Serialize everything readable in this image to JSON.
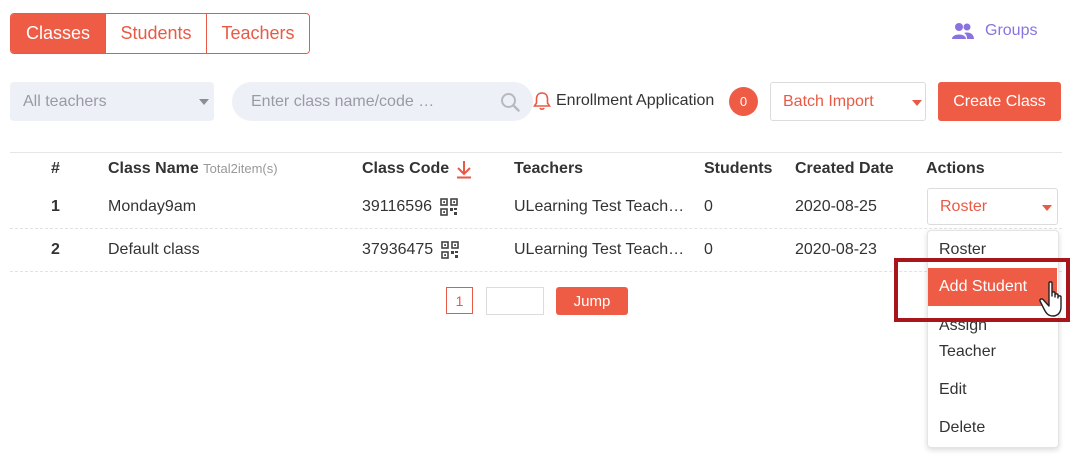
{
  "tabs": [
    {
      "label": "Classes",
      "active": true
    },
    {
      "label": "Students",
      "active": false
    },
    {
      "label": "Teachers",
      "active": false
    }
  ],
  "groups_link": {
    "label": "Groups",
    "icon": "users-icon"
  },
  "toolbar": {
    "teacher_filter": "All teachers",
    "search_placeholder": "Enter class name/code …",
    "enrollment_label": "Enrollment Application",
    "enrollment_count": "0",
    "batch_import": "Batch Import",
    "create_class": "Create Class"
  },
  "table": {
    "headers": {
      "num": "#",
      "class_name": "Class Name",
      "total": "Total2item(s)",
      "class_code": "Class Code",
      "teachers": "Teachers",
      "students": "Students",
      "created": "Created Date",
      "actions": "Actions"
    },
    "rows": [
      {
        "num": "1",
        "name": "Monday9am",
        "code": "39116596",
        "teachers": "ULearning Test Teach…",
        "students": "0",
        "created": "2020-08-25",
        "action": "Roster"
      },
      {
        "num": "2",
        "name": "Default class",
        "code": "37936475",
        "teachers": "ULearning Test Teach…",
        "students": "0",
        "created": "2020-08-23"
      }
    ]
  },
  "pagination": {
    "page": "1",
    "jump_label": "Jump"
  },
  "actions_menu": {
    "items": [
      "Roster",
      "Add Student",
      "Assign",
      "Teacher",
      "Edit",
      "Delete"
    ]
  },
  "colors": {
    "accent": "#ef5c46",
    "groups": "#8a73e0",
    "highlight": "#a8161c"
  }
}
